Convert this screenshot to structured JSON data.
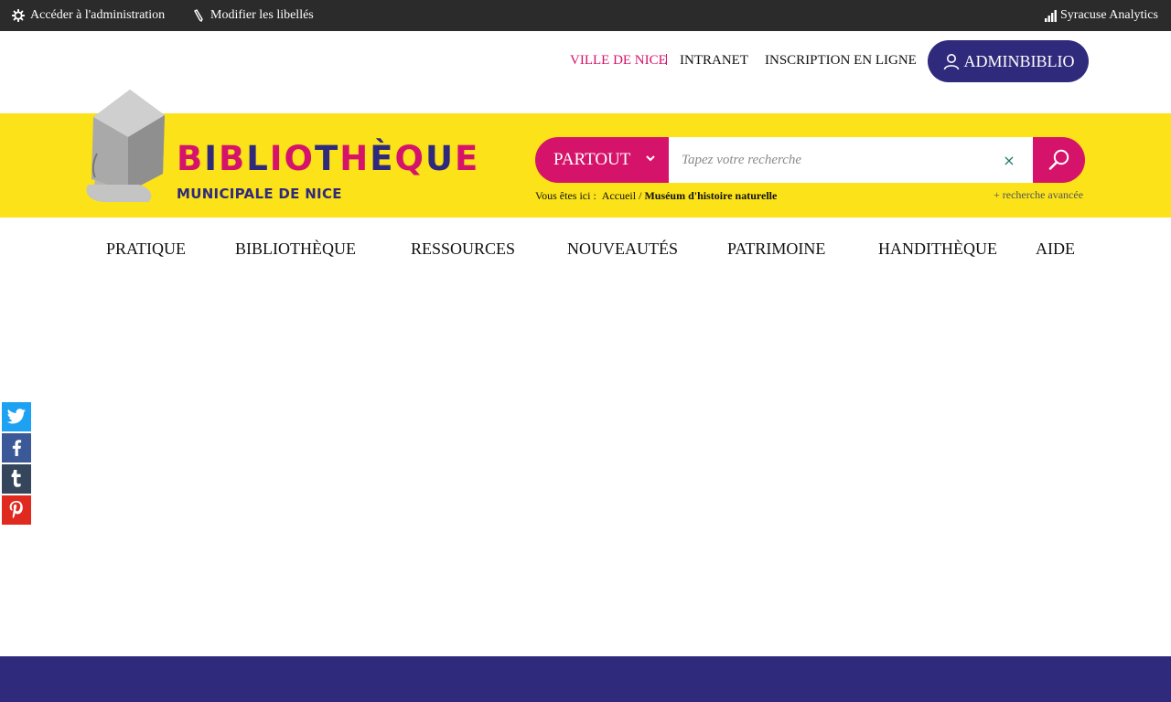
{
  "adminbar": {
    "admin_link": "Accéder à l'administration",
    "edit_labels": "Modifier les libellés",
    "analytics": "Syracuse Analytics"
  },
  "toplinks": {
    "ville": "VILLE DE NICE",
    "intranet": "INTRANET",
    "inscription": "INSCRIPTION EN LIGNE",
    "user": "ADMINBIBLIO"
  },
  "logo": {
    "title_letters": [
      "B",
      "I",
      "B",
      "L",
      "I",
      "O",
      "T",
      "H",
      "È",
      "Q",
      "U",
      "E"
    ],
    "subtitle": "MUNICIPALE DE NICE"
  },
  "search": {
    "scope": "PARTOUT",
    "placeholder": "Tapez votre recherche",
    "clear": "×",
    "advanced": "+  recherche avancée"
  },
  "breadcrumb": {
    "prefix": "Vous êtes ici :",
    "home": "Accueil",
    "separator": "/",
    "current": "Muséum d'histoire naturelle"
  },
  "nav": [
    "PRATIQUE",
    "BIBLIOTHÈQUE",
    "RESSOURCES",
    "NOUVEAUTÉS",
    "PATRIMOINE",
    "HANDITHÈQUE",
    "AIDE"
  ],
  "social": [
    {
      "icon": "twitter-icon",
      "color": "#1da1f2"
    },
    {
      "icon": "facebook-icon",
      "color": "#3b5998"
    },
    {
      "icon": "tumblr-icon",
      "color": "#35465c"
    },
    {
      "icon": "pinterest-icon",
      "color": "#e02a20"
    }
  ],
  "colors": {
    "brand_pink": "#d6136a",
    "brand_navy": "#302a7c",
    "brand_yellow": "#fbe219"
  }
}
